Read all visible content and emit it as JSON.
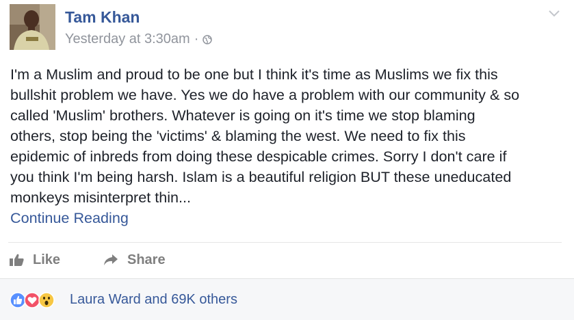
{
  "post": {
    "author": "Tam Khan",
    "timestamp": "Yesterday at 3:30am",
    "separator": "·",
    "privacy_icon": "globe-icon",
    "options_icon": "chevron-down-icon",
    "body": "I'm a Muslim and proud to be one but I think it's time as Muslims we fix this\nbullshit problem we have. Yes we do have a problem with our community & so\ncalled 'Muslim' brothers. Whatever is going on it's time we stop blaming\nothers, stop being the 'victims' & blaming the west. We need to fix this\nepidemic of inbreds from doing these despicable crimes. Sorry I don't care if\nyou think I'm being harsh. Islam is a beautiful religion BUT these uneducated\nmonkeys misinterpret thin...",
    "continue_label": "Continue Reading"
  },
  "actions": {
    "like_label": "Like",
    "like_icon": "thumbs-up-icon",
    "share_label": "Share",
    "share_icon": "share-arrow-icon"
  },
  "reactions": {
    "icons": [
      "like-reaction-icon",
      "love-reaction-icon",
      "wow-reaction-icon"
    ],
    "summary": "Laura Ward and 69K others"
  },
  "colors": {
    "link": "#365899",
    "meta": "#90949c",
    "text": "#1d2129",
    "action": "#7f7f7f",
    "footer_bg": "#f6f7f9"
  }
}
